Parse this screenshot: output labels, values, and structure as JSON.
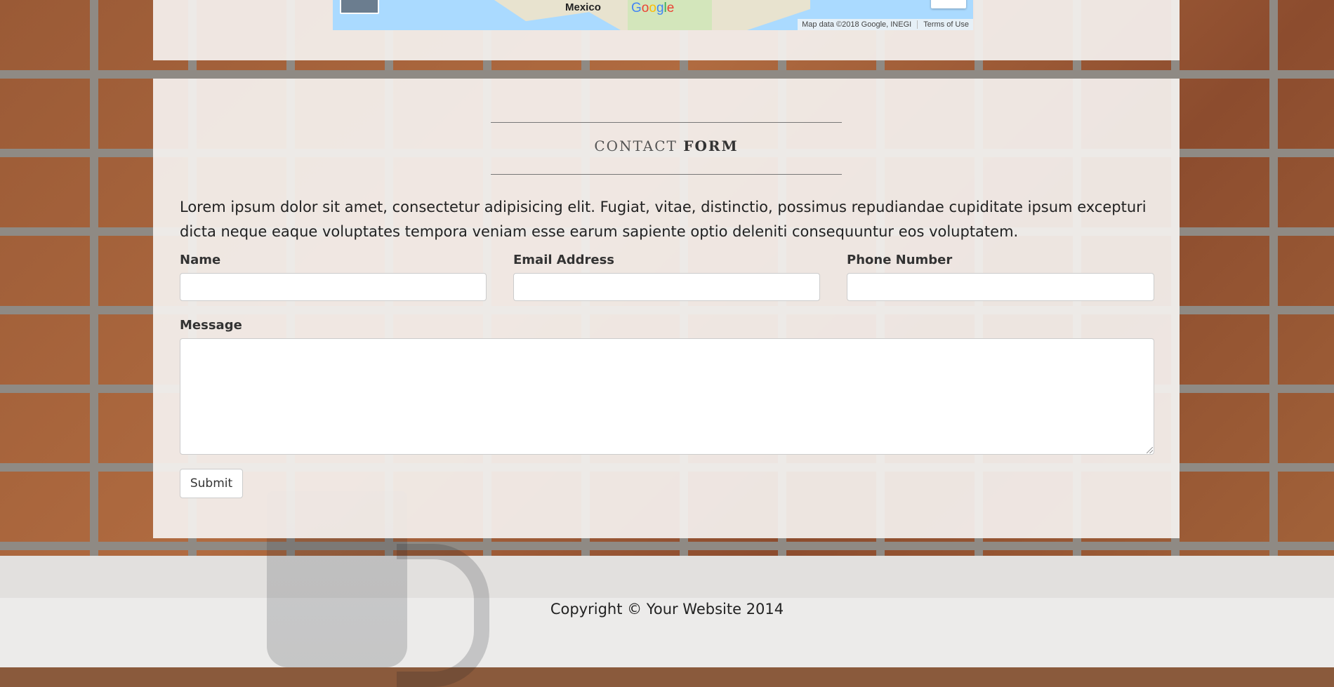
{
  "map": {
    "region_label": "Mexico",
    "logo_letters": [
      "G",
      "o",
      "o",
      "g",
      "l",
      "e"
    ],
    "attribution": "Map data ©2018 Google, INEGI",
    "terms": "Terms of Use"
  },
  "contact": {
    "title_light": "CONTACT",
    "title_bold": "FORM",
    "intro": "Lorem ipsum dolor sit amet, consectetur adipisicing elit. Fugiat, vitae, distinctio, possimus repudiandae cupiditate ipsum excepturi dicta neque eaque voluptates tempora veniam esse earum sapiente optio deleniti consequuntur eos voluptatem.",
    "fields": {
      "name_label": "Name",
      "name_value": "",
      "email_label": "Email Address",
      "email_value": "",
      "phone_label": "Phone Number",
      "phone_value": "",
      "message_label": "Message",
      "message_value": ""
    },
    "submit_label": "Submit"
  },
  "footer": {
    "copyright": "Copyright © Your Website 2014"
  }
}
